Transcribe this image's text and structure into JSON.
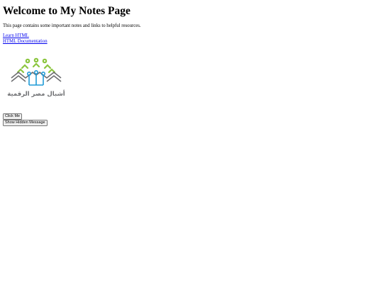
{
  "page": {
    "title": "Welcome to My Notes Page",
    "intro": "This page contains some important notes and links to helpful resources."
  },
  "links": [
    {
      "label": "Learn HTML"
    },
    {
      "label": "HTML Documentation"
    }
  ],
  "logo": {
    "icon": "tree-circuit-logo",
    "text": "أشبال مصر الرقمية",
    "colors": {
      "green": "#8cc63f",
      "blue": "#1f9bd7",
      "gray": "#6d6e71"
    }
  },
  "buttons": [
    {
      "label": "Click Me"
    },
    {
      "label": "Show Hidden Message"
    }
  ]
}
